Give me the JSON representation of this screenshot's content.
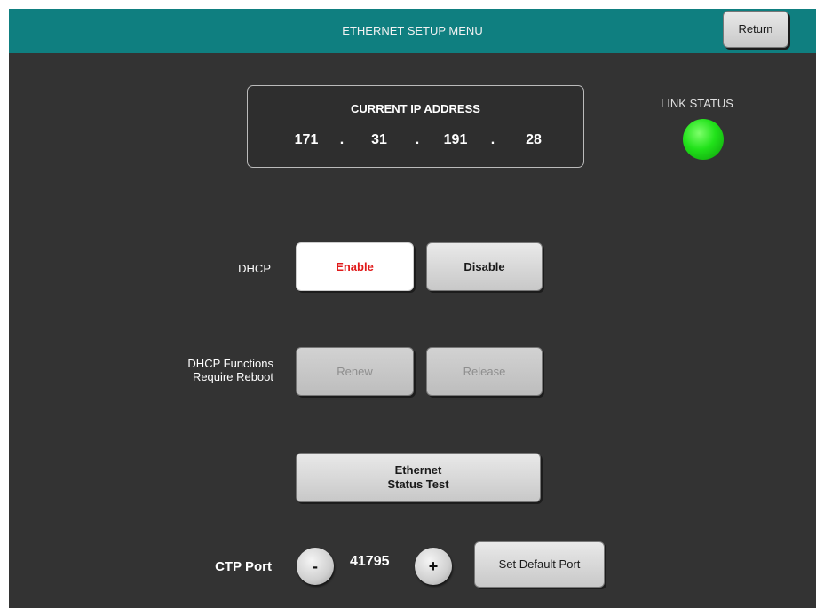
{
  "header": {
    "title": "ETHERNET SETUP MENU",
    "return_label": "Return"
  },
  "ip": {
    "label": "CURRENT IP ADDRESS",
    "octets": [
      "171",
      "31",
      "191",
      "28"
    ],
    "separator": "."
  },
  "link_status": {
    "label": "LINK STATUS",
    "color": "#22e01c"
  },
  "dhcp": {
    "label": "DHCP",
    "enable_label": "Enable",
    "disable_label": "Disable"
  },
  "dhcp_functions": {
    "label": "DHCP Functions\nRequire Reboot",
    "renew_label": "Renew",
    "release_label": "Release"
  },
  "ethernet_test": {
    "label": "Ethernet\nStatus Test"
  },
  "ctp_port": {
    "label": "CTP Port",
    "decrement_label": "-",
    "value": "41795",
    "increment_label": "+",
    "default_label": "Set Default Port"
  },
  "colors": {
    "header": "#0f7f80",
    "background": "#333333",
    "active_text": "#e01b1b"
  }
}
